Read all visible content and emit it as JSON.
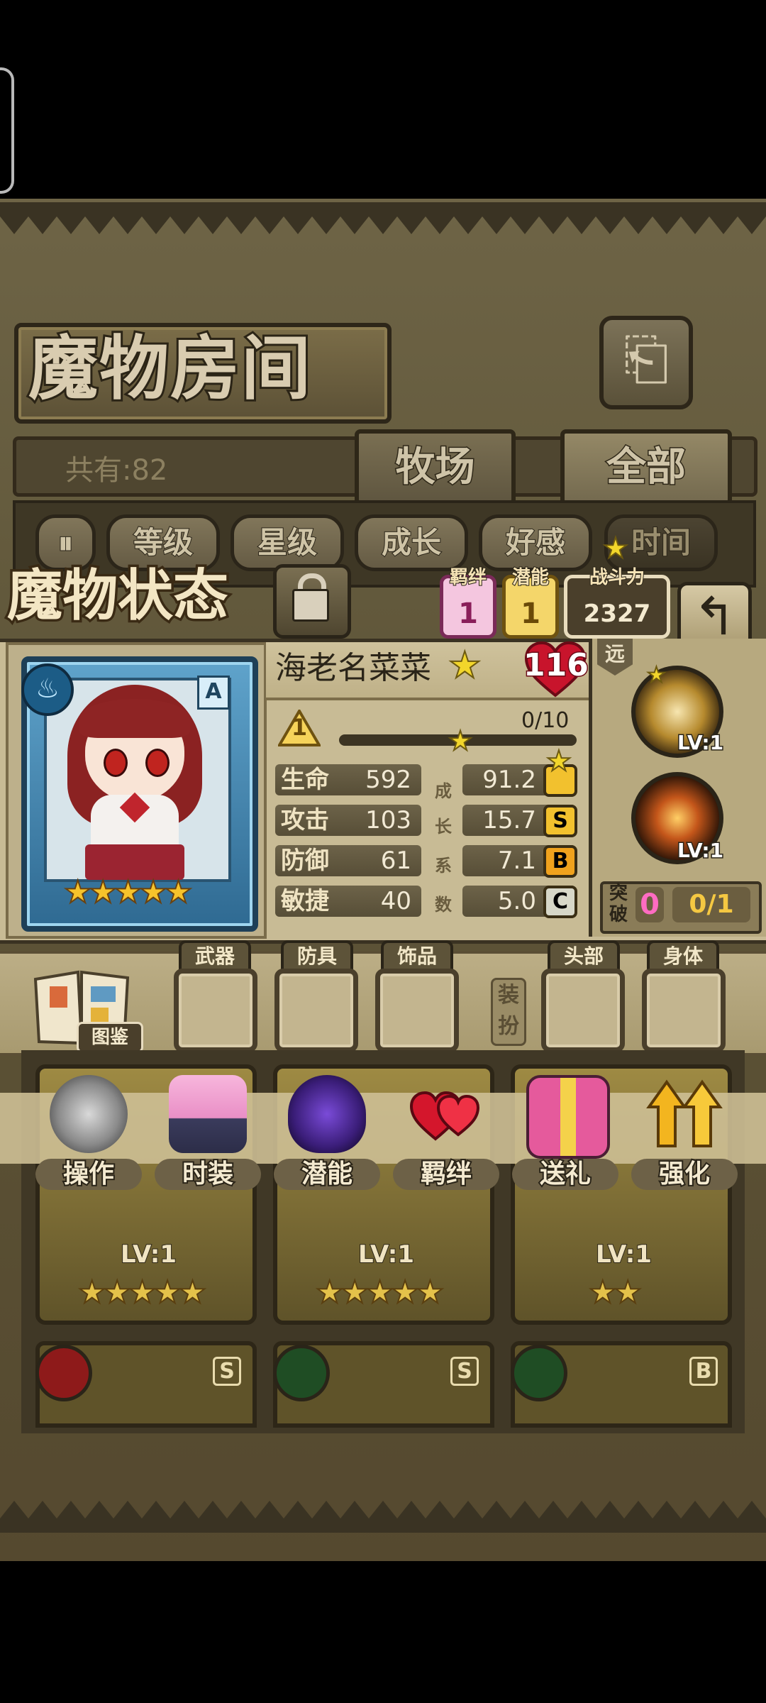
{
  "header": {
    "title": "魔物房间",
    "exit_icon": "exit-icon"
  },
  "collection": {
    "count_text": "共有:82",
    "tabs": [
      "牧场",
      "全部"
    ]
  },
  "sort": {
    "toggle_icon": "sort-toggle-icon",
    "options": [
      "等级",
      "星级",
      "成长",
      "好感",
      "时间"
    ]
  },
  "status": {
    "title": "魔物状态",
    "bond_label": "羁绊",
    "bond_value": "1",
    "potential_label": "潜能",
    "potential_value": "1",
    "power_label": "战斗力",
    "power_value": "2327"
  },
  "monster": {
    "name": "海老名菜菜",
    "level": "116",
    "rank": "A",
    "element_icon": "water-icon",
    "stars": "★★★★★",
    "bond_level": "1",
    "exp_text": "0/10",
    "exp_fraction": 0.0,
    "growth_chars": [
      "成",
      "长",
      "系",
      "数"
    ],
    "stats": [
      {
        "label": "生命",
        "value": "592",
        "growth": "91.2",
        "grade": ""
      },
      {
        "label": "攻击",
        "value": "103",
        "growth": "15.7",
        "grade": "S"
      },
      {
        "label": "防御",
        "value": "61",
        "growth": "7.1",
        "grade": "B"
      },
      {
        "label": "敏捷",
        "value": "40",
        "growth": "5.0",
        "grade": "C"
      }
    ],
    "range": "远",
    "skills": [
      {
        "icon": "holy-skill-icon",
        "level": "LV:1"
      },
      {
        "icon": "fire-sword-skill-icon",
        "level": "LV:1"
      }
    ],
    "breakthrough_label": "突破",
    "breakthrough_count": "0",
    "breakthrough_progress": "0/1"
  },
  "equipment": {
    "codex_label": "图鉴",
    "slots": [
      "武器",
      "防具",
      "饰品",
      "头部",
      "身体"
    ],
    "dress_label": "装扮"
  },
  "actions": [
    {
      "label": "操作",
      "icon": "gear-icon"
    },
    {
      "label": "时装",
      "icon": "outfit-icon"
    },
    {
      "label": "潜能",
      "icon": "potential-icon"
    },
    {
      "label": "羁绊",
      "icon": "bond-hearts-icon"
    },
    {
      "label": "送礼",
      "icon": "gift-icon"
    },
    {
      "label": "强化",
      "icon": "upgrade-arrows-icon"
    }
  ],
  "monster_cards": [
    {
      "level": "LV:1",
      "stars": "★★★★★"
    },
    {
      "level": "LV:1",
      "stars": "★★★★★"
    },
    {
      "level": "LV:1",
      "stars": "★★"
    }
  ],
  "bottom_cards": [
    {
      "element_icon": "fire-icon",
      "grade": "S"
    },
    {
      "element_icon": "leaf-icon",
      "grade": "S"
    },
    {
      "element_icon": "leaf-icon",
      "grade": "B"
    }
  ],
  "colors": {
    "grade_top": "#f2c12e",
    "grade_S": "#f2c12e",
    "grade_B": "#f0a21d",
    "grade_C": "#d7d7c8",
    "level_heart": "#c8142c",
    "bond_badge": "#f06ab0"
  }
}
